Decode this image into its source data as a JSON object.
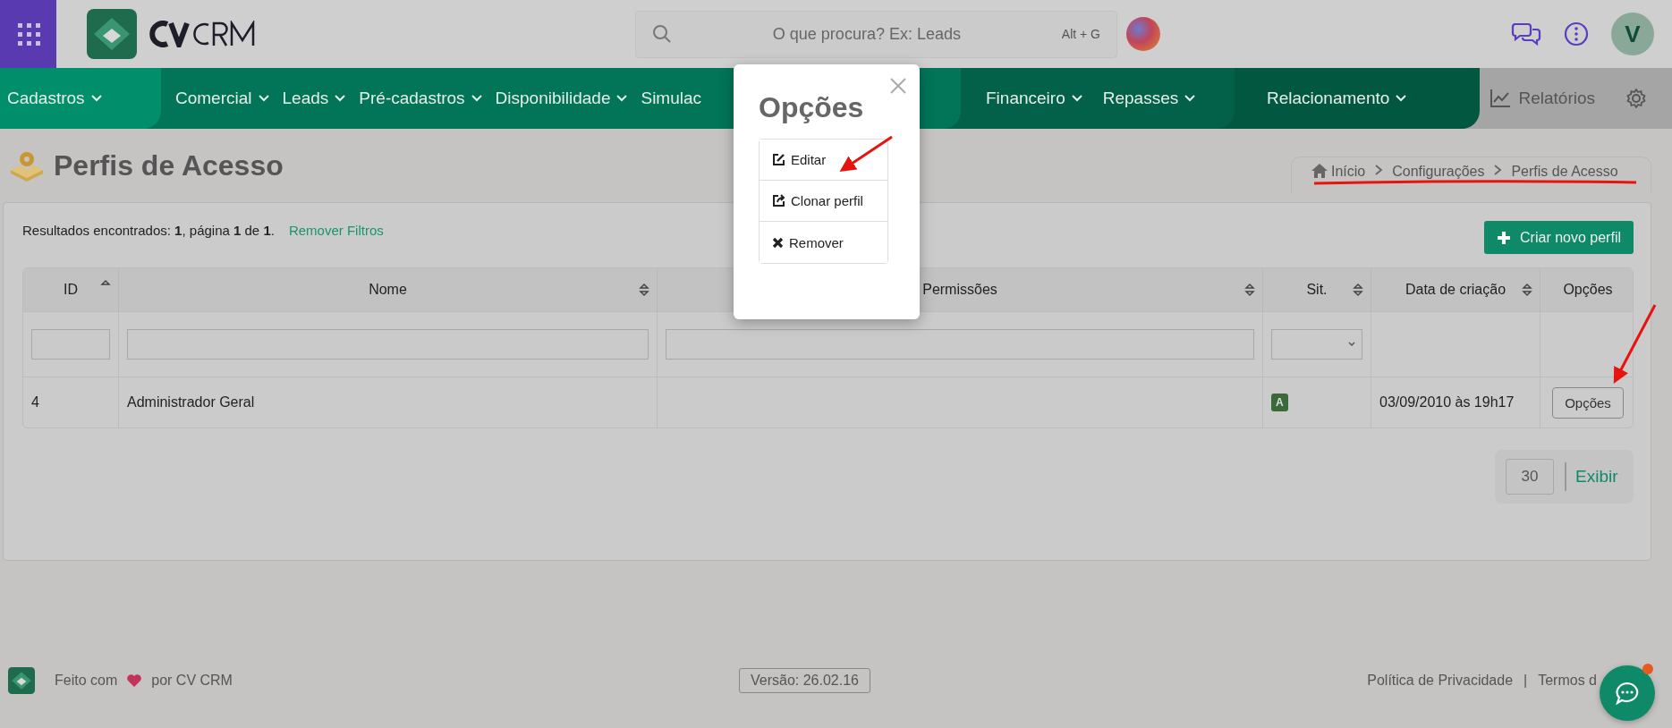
{
  "top_bar": {
    "search": {
      "placeholder": "O que procura? Ex: Leads",
      "shortcut": "Alt + G"
    },
    "user_initial": "V"
  },
  "nav": {
    "groups": [
      {
        "items": [
          {
            "label": "Cadastros",
            "dropdown": true
          }
        ]
      },
      {
        "items": [
          {
            "label": "Comercial",
            "dropdown": true
          },
          {
            "label": "Leads",
            "dropdown": true
          },
          {
            "label": "Pré-cadastros",
            "dropdown": true
          },
          {
            "label": "Disponibilidade",
            "dropdown": true
          },
          {
            "label": "Simulac",
            "dropdown": false
          }
        ]
      },
      {
        "items": [
          {
            "label": "Financeiro",
            "dropdown": true
          },
          {
            "label": "Repasses",
            "dropdown": true
          }
        ]
      },
      {
        "items": [
          {
            "label": "Relacionamento",
            "dropdown": true
          }
        ]
      }
    ],
    "reports": "Relatórios"
  },
  "page": {
    "title": "Perfis de Acesso",
    "breadcrumb": [
      "Início",
      "Configurações",
      "Perfis de Acesso"
    ]
  },
  "results": {
    "text": "Resultados encontrados: **1**, página **1** de **1**.",
    "link": "Remover Filtros"
  },
  "create_button": "Criar novo perfil",
  "table": {
    "columns": [
      {
        "label": "ID",
        "sortable": true,
        "sorted": true,
        "kind": "text"
      },
      {
        "label": "Nome",
        "sortable": true,
        "sorted": false,
        "kind": "text"
      },
      {
        "label": "Permissões",
        "sortable": true,
        "sorted": false,
        "kind": "text"
      },
      {
        "label": "Sit.",
        "sortable": true,
        "sorted": false,
        "kind": "select"
      },
      {
        "label": "Data de criação",
        "sortable": true,
        "sorted": false,
        "kind": "none"
      },
      {
        "label": "Opções",
        "sortable": false,
        "kind": "none"
      }
    ],
    "rows": [
      {
        "id": "4",
        "name": "Administrador Geral",
        "status": "A",
        "created": "03/09/2010 às 19h17",
        "action": "Opções"
      }
    ]
  },
  "pagination": {
    "page_size": "30",
    "action": "Exibir"
  },
  "footer": {
    "made_with": "Feito com",
    "by": "por CV CRM",
    "version": "Versão: 26.02.16",
    "links": [
      "Política de Privacidade",
      "Termos d"
    ],
    "separator": "|"
  },
  "modal": {
    "title": "Opções",
    "options": [
      {
        "label": "Editar",
        "kind": "edit"
      },
      {
        "label": "Clonar perfil",
        "kind": "clone"
      },
      {
        "label": "Remover",
        "kind": "remove"
      }
    ]
  }
}
